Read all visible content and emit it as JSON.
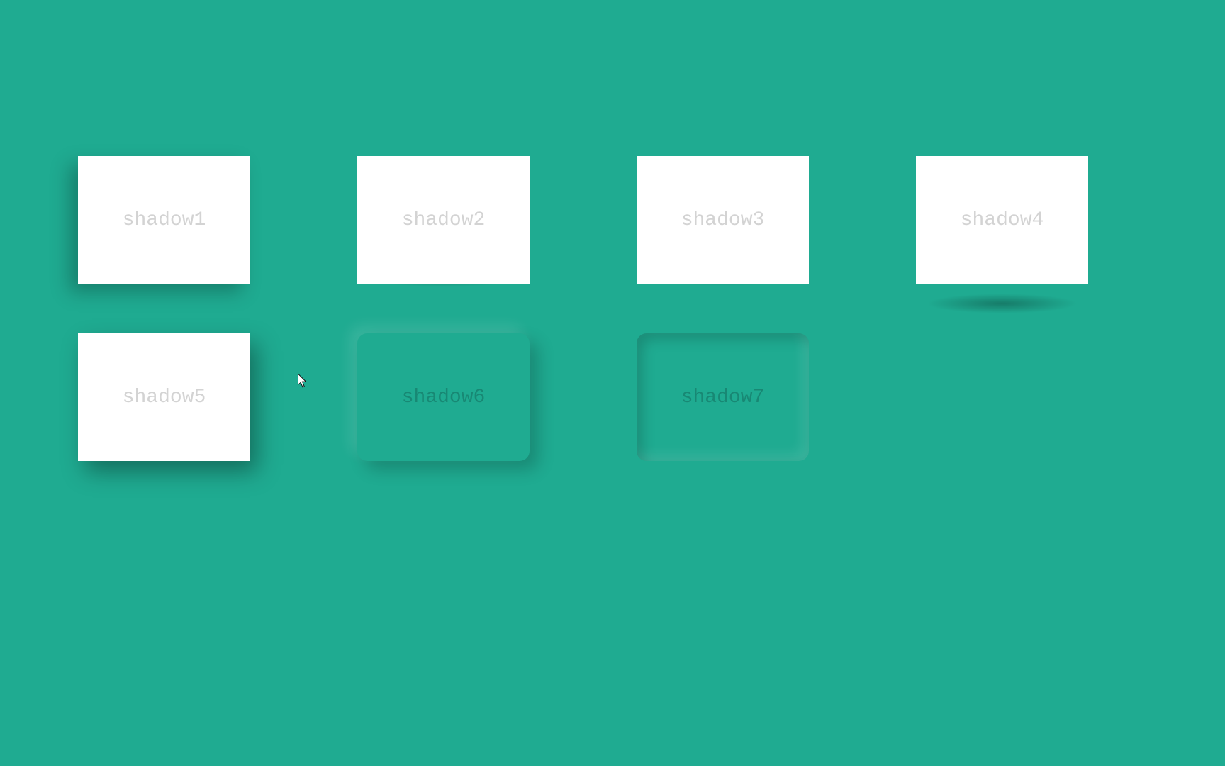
{
  "cards": [
    {
      "label": "shadow1"
    },
    {
      "label": "shadow2"
    },
    {
      "label": "shadow3"
    },
    {
      "label": "shadow4"
    },
    {
      "label": "shadow5"
    },
    {
      "label": "shadow6"
    },
    {
      "label": "shadow7"
    }
  ]
}
